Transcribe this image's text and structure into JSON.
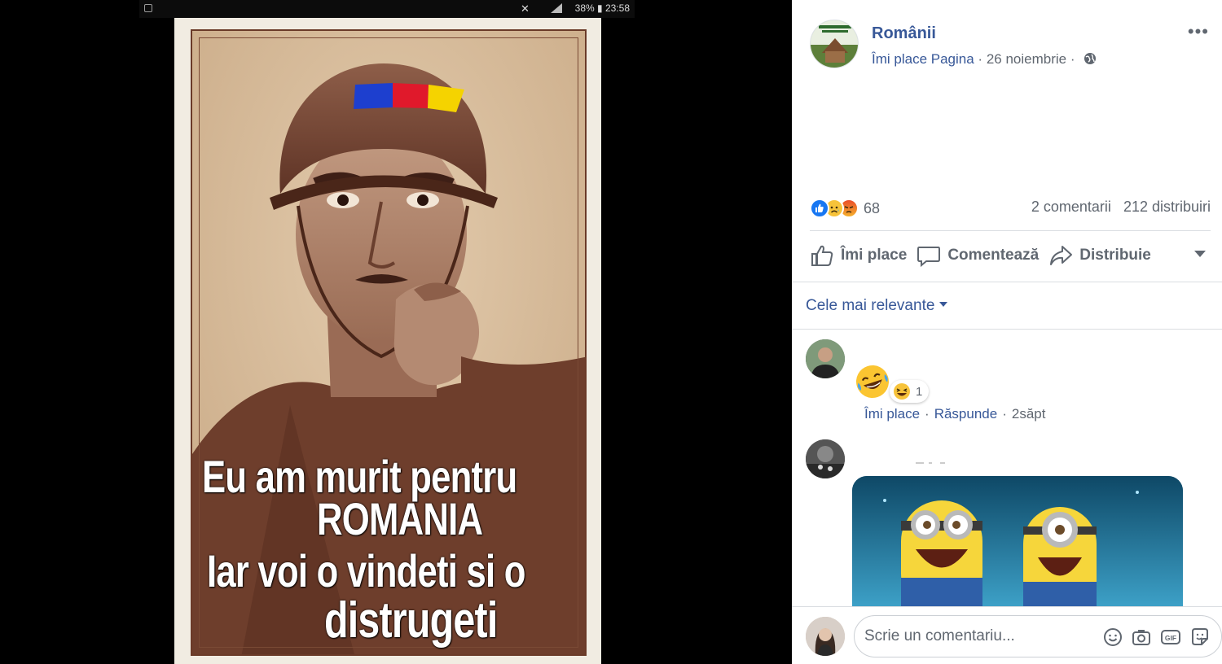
{
  "phone_status": {
    "battery_time": "38% ▮ 23:58"
  },
  "poster": {
    "lines": [
      "Eu am murit   pentru",
      "ROMANIA",
      "Iar voi o  vindeti si o",
      "distrugeti"
    ],
    "flag_colors": [
      "#1d3fcf",
      "#e0192b",
      "#f5d300"
    ]
  },
  "post": {
    "page_name": "Românii",
    "like_page": "Îmi place Pagina",
    "date": "26 noiembrie",
    "separator": "·",
    "reaction_count": "68",
    "comments": "2 comentarii",
    "shares": "212 distribuiri",
    "actions": {
      "like": "Îmi place",
      "comment": "Comentează",
      "share": "Distribuie"
    },
    "reaction_icons": [
      "like-icon",
      "sad-icon",
      "angry-icon"
    ]
  },
  "comments_section": {
    "sort_label": "Cele mai relevante",
    "comment1": {
      "emoji": "laughing-emoji",
      "reaction_count": "1",
      "like": "Îmi place",
      "reply": "Răspunde",
      "time": "2săpt"
    },
    "comment2": {
      "gif": "minions-laughing-gif"
    }
  },
  "composer": {
    "placeholder": "Scrie un comentariu..."
  },
  "colors": {
    "link": "#385898",
    "muted": "#606770",
    "border": "#dadde1"
  }
}
